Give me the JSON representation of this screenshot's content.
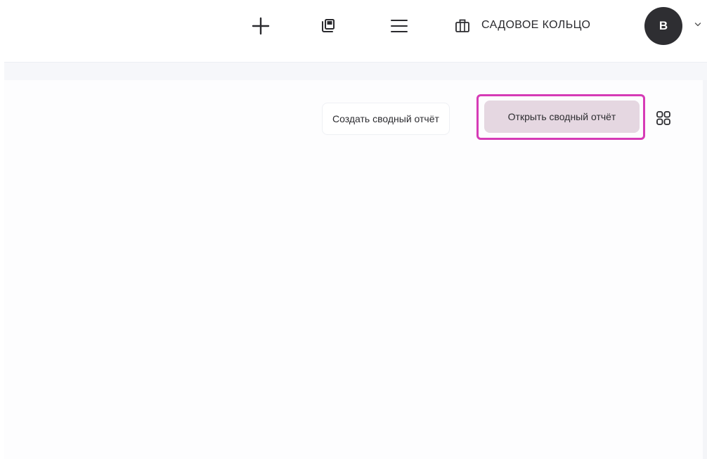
{
  "header": {
    "icons": {
      "add": "plus-icon",
      "copy": "copy-icon",
      "menu": "menu-icon",
      "organization": "briefcase-icon",
      "account_menu": "chevron-down-icon"
    },
    "organization_name": "САДОВОЕ КОЛЬЦО",
    "avatar_initial": "В"
  },
  "toolbar": {
    "create_report_label": "Создать сводный отчёт",
    "open_report_label": "Открыть сводный отчёт",
    "grid_icon": "grid-view-icon"
  },
  "colors": {
    "highlight": "#d63bb6",
    "open_button_bg": "#e5d7e1",
    "avatar_bg": "#2e2e32"
  }
}
